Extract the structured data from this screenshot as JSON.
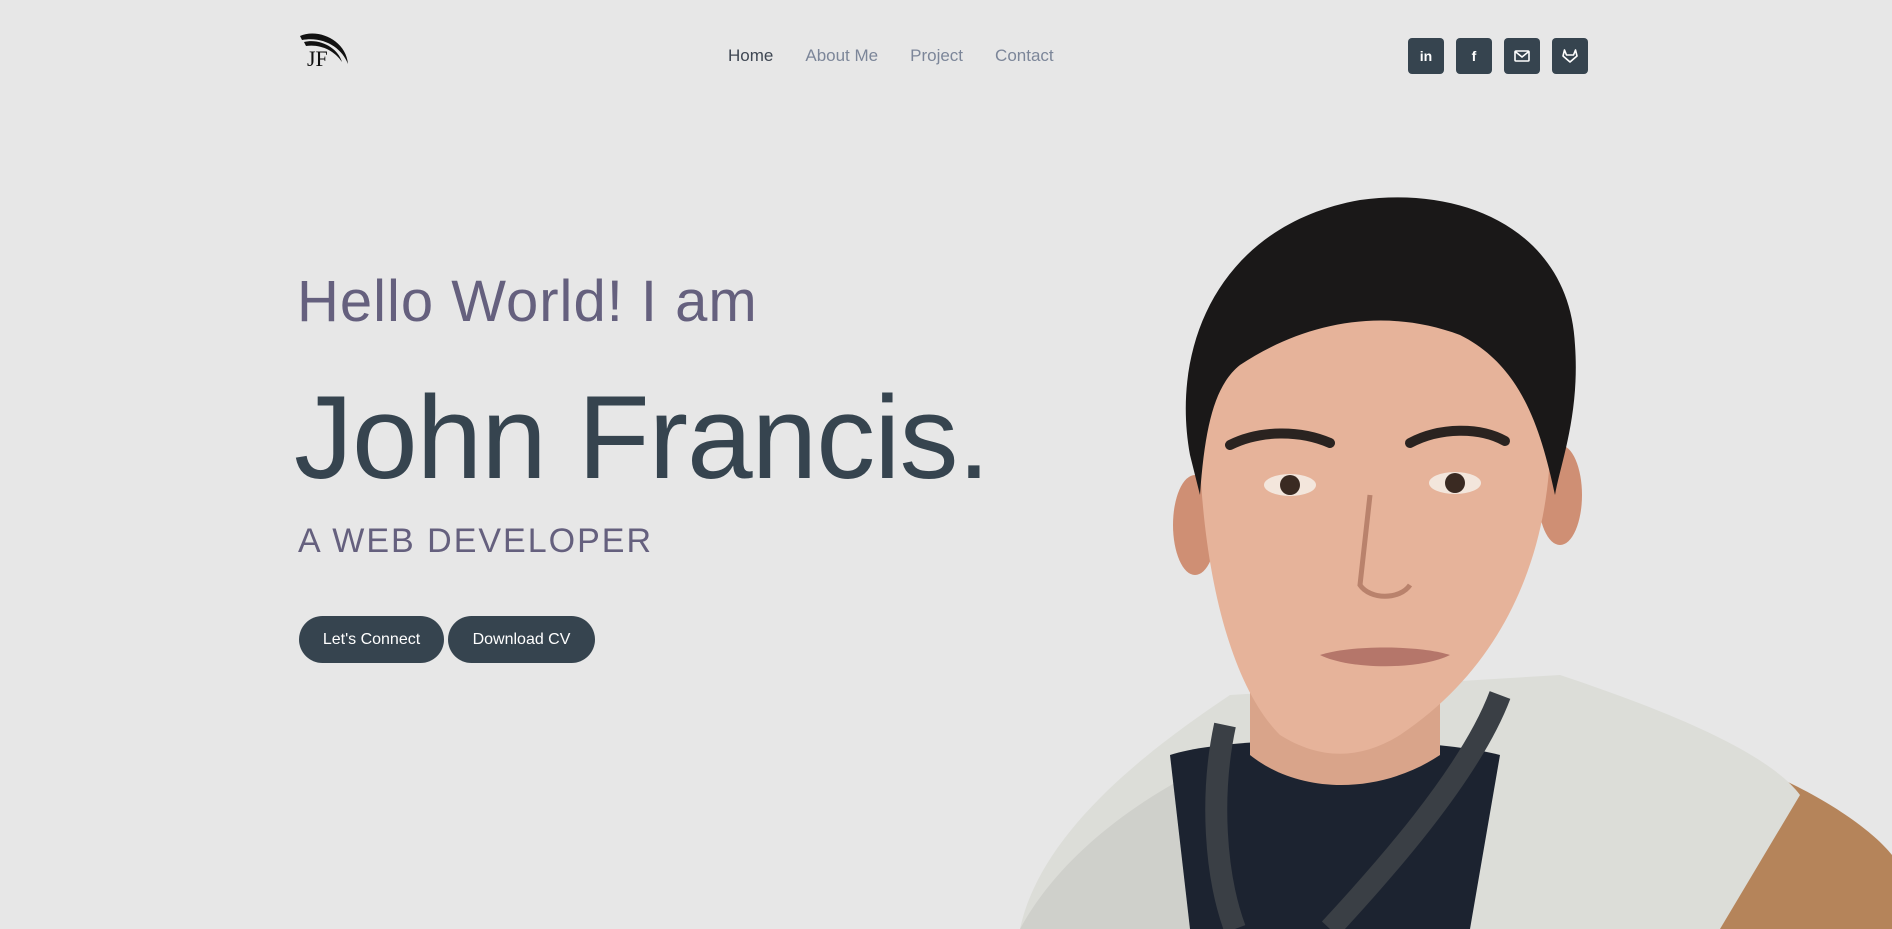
{
  "logo": {
    "text": "JF"
  },
  "nav": {
    "items": [
      {
        "label": "Home",
        "active": true
      },
      {
        "label": "About Me",
        "active": false
      },
      {
        "label": "Project",
        "active": false
      },
      {
        "label": "Contact",
        "active": false
      }
    ]
  },
  "social": [
    {
      "label": "in",
      "icon": "linkedin-icon"
    },
    {
      "label": "f",
      "icon": "facebook-icon"
    },
    {
      "label": "",
      "icon": "email-icon"
    },
    {
      "label": "",
      "icon": "gitlab-icon"
    }
  ],
  "hero": {
    "greeting": "Hello World! I am",
    "name": "John Francis.",
    "role": "A WEB DEVELOPER",
    "connect_label": "Let's Connect",
    "download_label": "Download CV"
  },
  "colors": {
    "background": "#e7e7e7",
    "primary": "#36444f",
    "accent": "#65607e",
    "nav_inactive": "#7c8699"
  }
}
